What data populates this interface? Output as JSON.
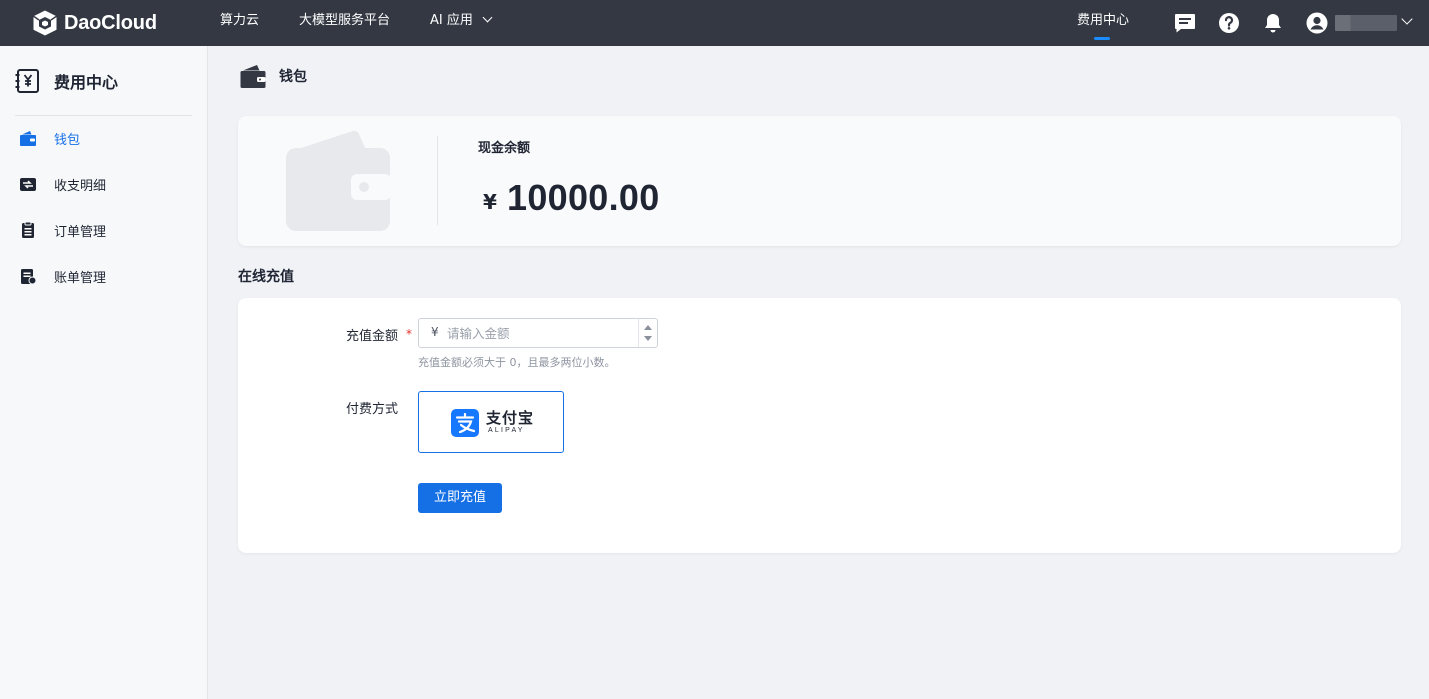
{
  "topbar": {
    "brand": "DaoCloud",
    "nav": [
      {
        "label": "算力云"
      },
      {
        "label": "大模型服务平台"
      },
      {
        "label": "AI 应用"
      }
    ],
    "active_nav": "费用中心",
    "icons": [
      "message-icon",
      "help-icon",
      "bell-icon",
      "user-icon",
      "chevron-down-icon"
    ]
  },
  "sidebar": {
    "title": "费用中心",
    "items": [
      {
        "label": "钱包",
        "icon": "wallet-icon",
        "active": true
      },
      {
        "label": "收支明细",
        "icon": "transactions-icon",
        "active": false
      },
      {
        "label": "订单管理",
        "icon": "order-icon",
        "active": false
      },
      {
        "label": "账单管理",
        "icon": "bill-icon",
        "active": false
      }
    ]
  },
  "page": {
    "title": "钱包"
  },
  "balance": {
    "label": "现金余额",
    "currency": "¥",
    "value": "10000.00"
  },
  "recharge": {
    "section_title": "在线充值",
    "amount_label": "充值金额",
    "required_mark": "*",
    "currency": "¥",
    "amount_placeholder": "请输入金额",
    "amount_value": "",
    "hint": "充值金额必须大于 0，且最多两位小数。",
    "payment_label": "付费方式",
    "payment_option": {
      "name_cn": "支付宝",
      "name_en": "ALIPAY"
    },
    "submit_label": "立即充值"
  },
  "colors": {
    "topbar": "#333842",
    "accent": "#1570e6",
    "active_indicator": "#1a8cff",
    "alipay": "#1677ff",
    "page_bg": "#f0f2f6"
  }
}
